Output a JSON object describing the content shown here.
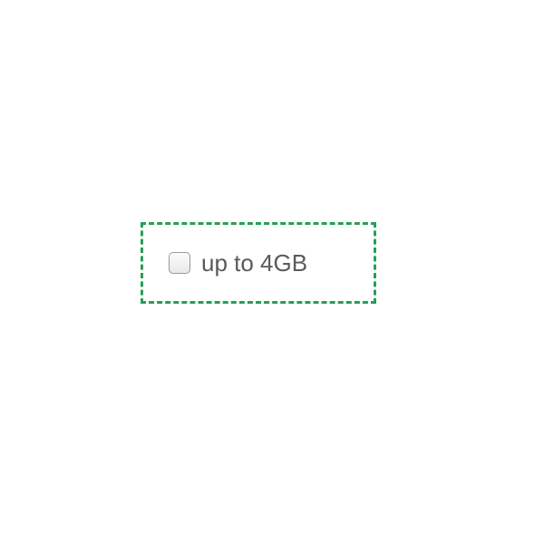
{
  "option": {
    "label": "up to 4GB",
    "checked": false,
    "border_color": "#26a053"
  }
}
